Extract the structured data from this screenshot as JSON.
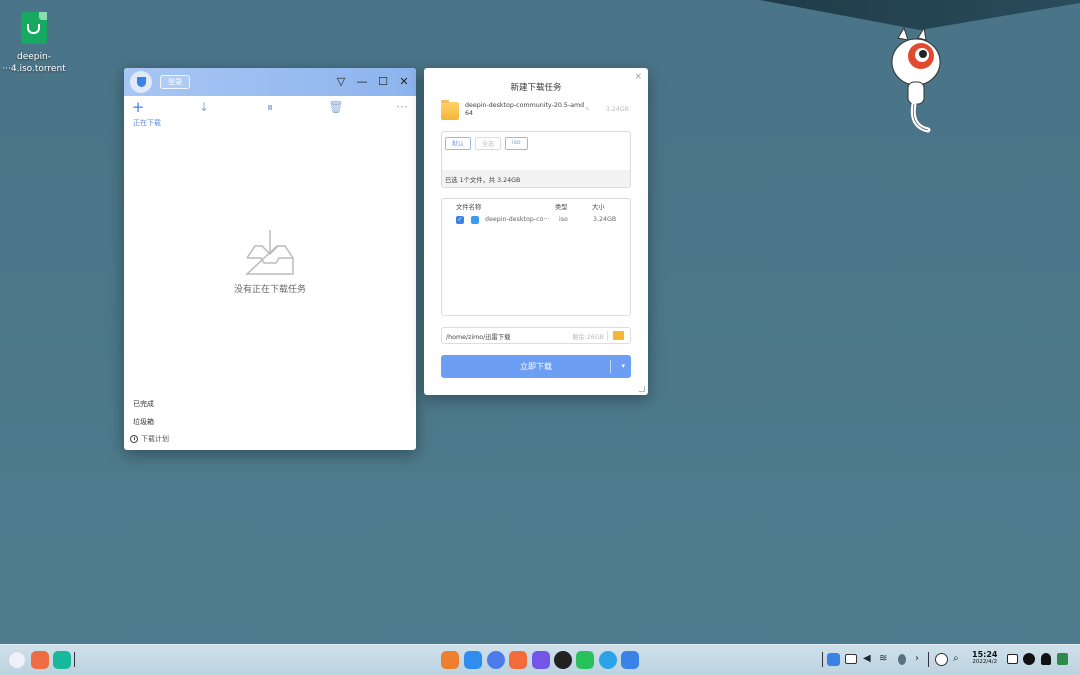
{
  "desktop": {
    "icons": [
      {
        "label_line1": "deepin-",
        "label_line2": "···4.iso.torrent",
        "icon": "torrent-file-icon"
      }
    ]
  },
  "downloader": {
    "login_label": "登录",
    "title_controls": {
      "menu": "▽",
      "minimize": "—",
      "maximize": "☐",
      "close": "✕"
    },
    "toolbar": {
      "add": "+",
      "start": "↓",
      "pause": "⏸",
      "delete": "🗑",
      "more": "···"
    },
    "section_downloading": "正在下载",
    "empty_text": "没有正在下载任务",
    "sidebar": {
      "completed": "已完成",
      "trash": "垃圾箱",
      "schedule": "下载计划"
    }
  },
  "dialog": {
    "title": "新建下载任务",
    "close": "×",
    "file": {
      "name": "deepin-desktop-community-20.5-amd64",
      "edit_hint": "✎",
      "size": "3.24GB"
    },
    "filters": [
      "默认",
      "全选",
      "iso"
    ],
    "summary": "已选 1个文件，共 3.24GB",
    "table": {
      "headers": {
        "name": "文件名称",
        "type": "类型",
        "size": "大小"
      },
      "rows": [
        {
          "checked": "✓",
          "name": "deepin-desktop-co···",
          "type": "iso",
          "size": "3.24GB"
        }
      ]
    },
    "save_path": "/home/zimo/迅雷下载",
    "free_space": "剩余:26GB",
    "download_button": "立即下载",
    "dropdown_caret": "▾"
  },
  "dock": {
    "apps": [
      {
        "name": "launcher",
        "color": "#e8eef6"
      },
      {
        "name": "multitask-view",
        "color": "#f06d44"
      },
      {
        "name": "desktop-toggle",
        "color": "#17b89b"
      },
      {
        "name": "file-manager",
        "color": "#ef7f2f"
      },
      {
        "name": "app-store",
        "color": "#2f8df0"
      },
      {
        "name": "control-center",
        "color": "#4b7be8"
      },
      {
        "name": "album",
        "color": "#f26b3a"
      },
      {
        "name": "camera",
        "color": "#7356e8"
      },
      {
        "name": "video-player",
        "color": "#222222"
      },
      {
        "name": "music",
        "color": "#28c15c"
      },
      {
        "name": "browser",
        "color": "#2aa3e8"
      },
      {
        "name": "downloader",
        "color": "#3b82e6"
      }
    ],
    "tray": {
      "wifi": "≋",
      "volume": "◀",
      "arrow": "›",
      "search": "⌕",
      "time": "15:24",
      "date": "2022/4/2"
    }
  }
}
